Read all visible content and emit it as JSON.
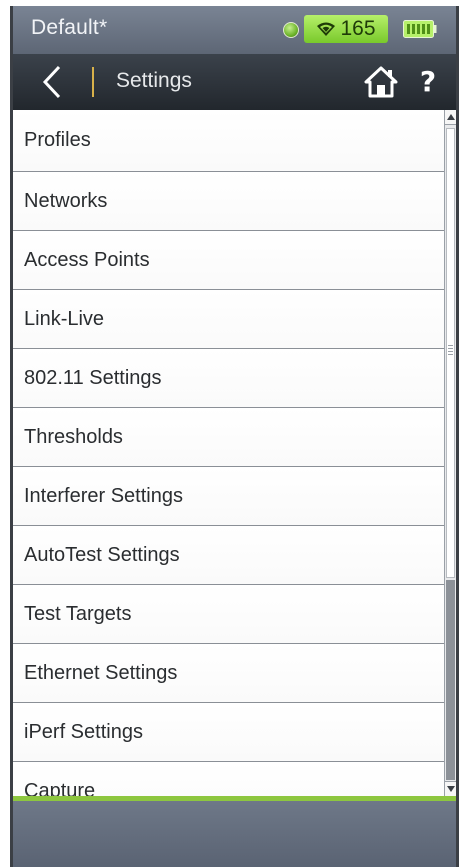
{
  "status_bar": {
    "profile_name": "Default*",
    "signal_value": "165",
    "icons": [
      "globe-icon",
      "wifi-icon",
      "battery-icon"
    ]
  },
  "nav_bar": {
    "title": "Settings",
    "icons": [
      "back-chevron-icon",
      "home-icon",
      "help-icon"
    ],
    "help_label": "?"
  },
  "menu": {
    "items": [
      {
        "label": "Profiles"
      },
      {
        "label": "Networks"
      },
      {
        "label": "Access Points"
      },
      {
        "label": "Link-Live"
      },
      {
        "label": "802.11 Settings"
      },
      {
        "label": "Thresholds"
      },
      {
        "label": "Interferer Settings"
      },
      {
        "label": "AutoTest Settings"
      },
      {
        "label": "Test Targets"
      },
      {
        "label": "Ethernet Settings"
      },
      {
        "label": "iPerf Settings"
      },
      {
        "label": "Capture"
      }
    ]
  },
  "colors": {
    "status_bar": "#6a7382",
    "nav_bar": "#2b3037",
    "wifi_badge": "#8fd63a",
    "accent_divider": "#d8b14a",
    "bottom_accent": "#8dc63f"
  }
}
